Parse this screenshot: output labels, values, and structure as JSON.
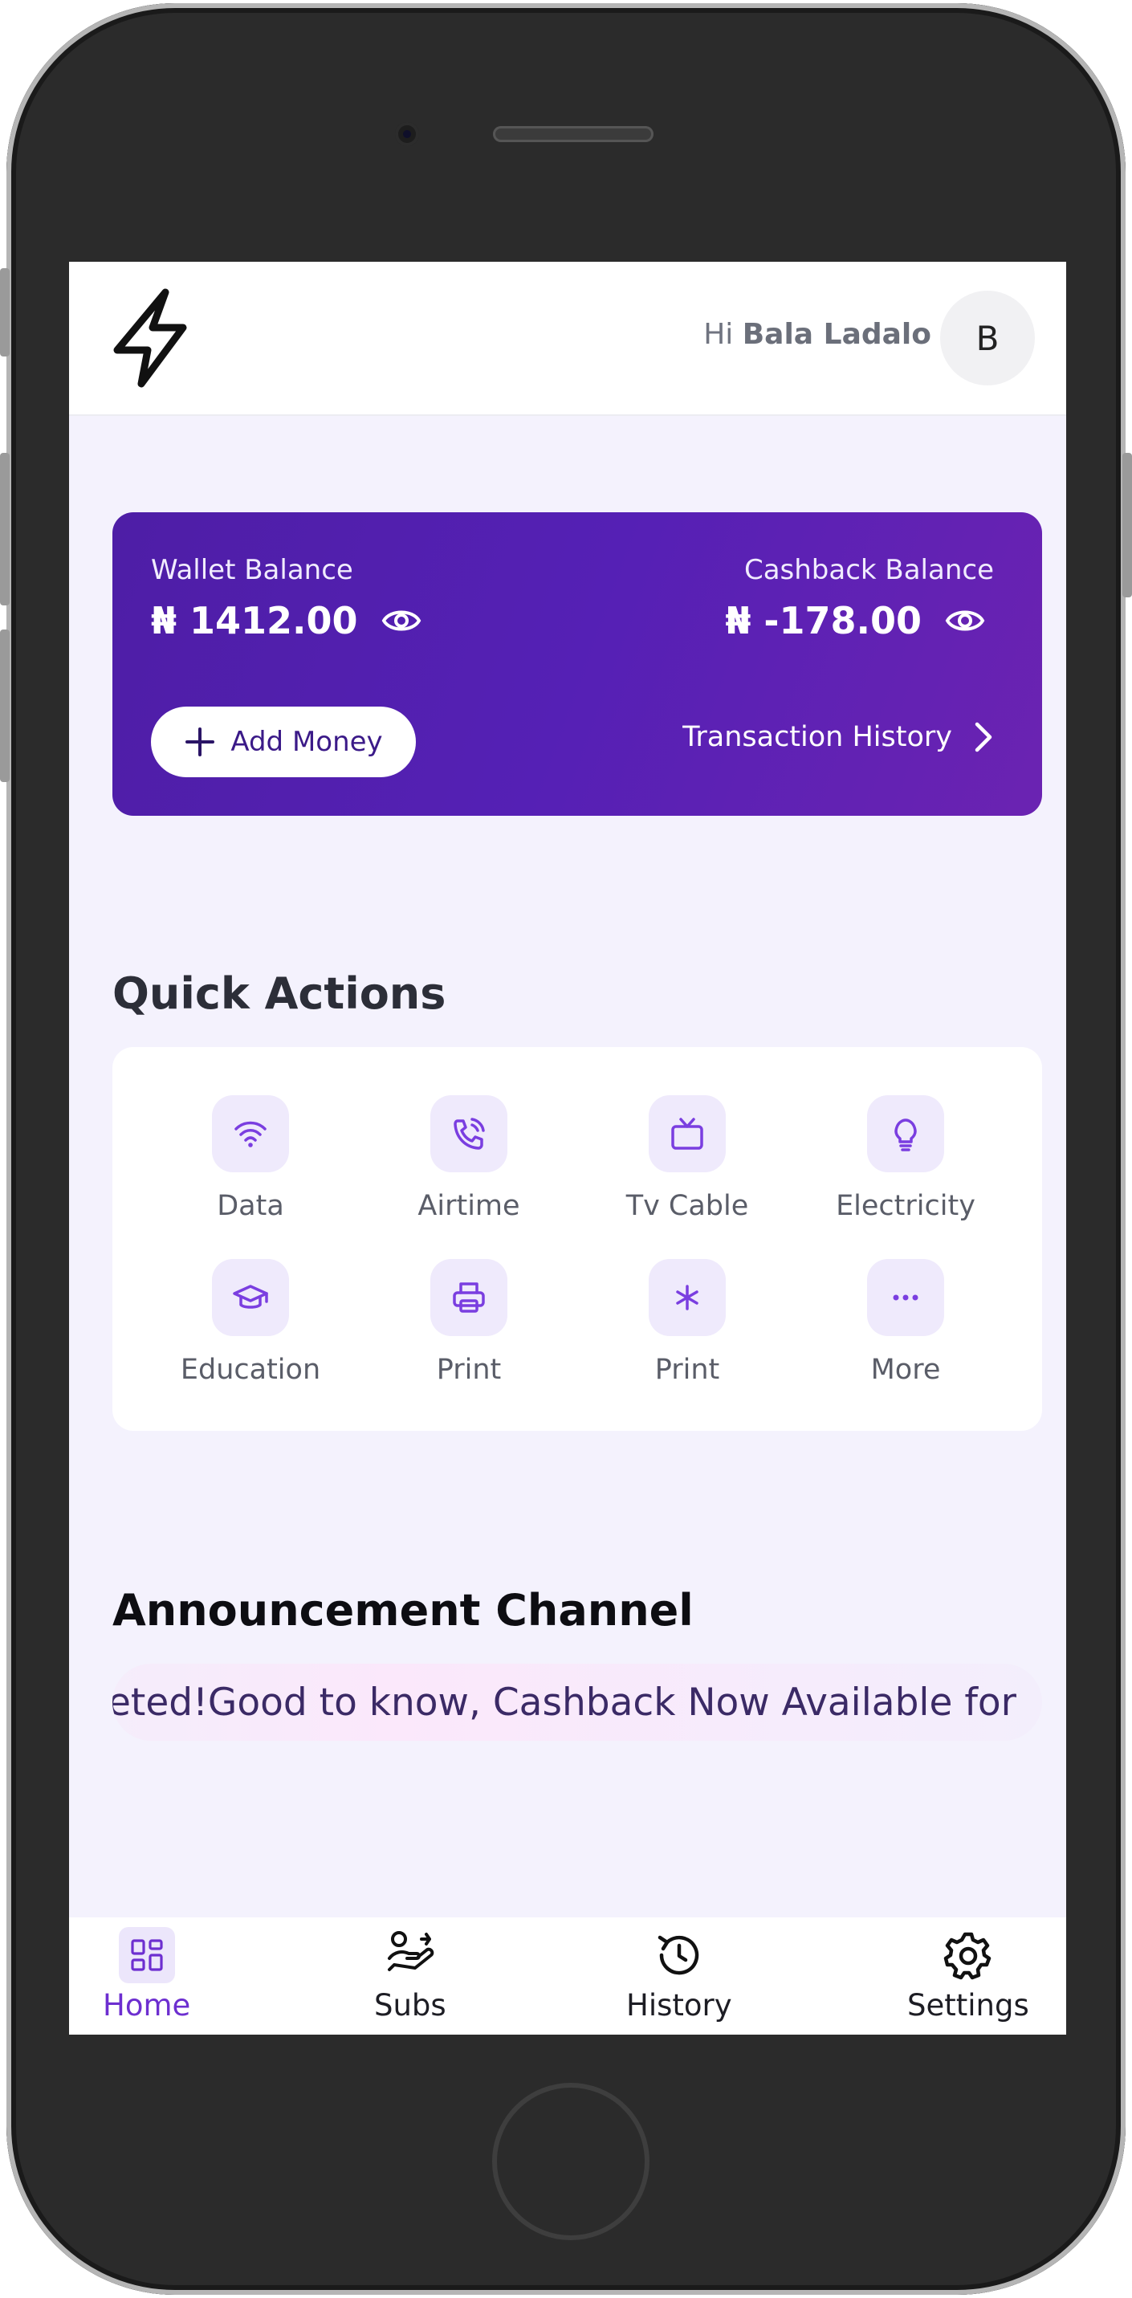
{
  "header": {
    "greeting_prefix": "Hi",
    "user_name": "Bala Ladalo",
    "avatar_initial": "B"
  },
  "wallet": {
    "wallet_label": "Wallet Balance",
    "wallet_amount": "₦ 1412.00",
    "cashback_label": "Cashback Balance",
    "cashback_amount": "₦ -178.00",
    "add_money_label": "Add Money",
    "transaction_history_label": "Transaction History",
    "card_color": "#5520b5"
  },
  "quick_actions": {
    "title": "Quick Actions",
    "items": [
      {
        "label": "Data",
        "icon": "wifi-icon"
      },
      {
        "label": "Airtime",
        "icon": "phone-call-icon"
      },
      {
        "label": "Tv Cable",
        "icon": "tv-icon"
      },
      {
        "label": "Electricity",
        "icon": "lightbulb-icon"
      },
      {
        "label": "Education",
        "icon": "graduation-cap-icon"
      },
      {
        "label": "Print",
        "icon": "printer-icon"
      },
      {
        "label": "Print",
        "icon": "asterisk-icon"
      },
      {
        "label": "More",
        "icon": "more-dots-icon"
      }
    ]
  },
  "announcement": {
    "title": "Announcement Channel",
    "ticker_text": "eted!Good to know, Cashback Now Available for"
  },
  "bottom_nav": {
    "items": [
      {
        "label": "Home",
        "icon": "dashboard-icon",
        "active": true
      },
      {
        "label": "Subs",
        "icon": "hand-coins-icon",
        "active": false
      },
      {
        "label": "History",
        "icon": "history-icon",
        "active": false
      },
      {
        "label": "Settings",
        "icon": "gear-icon",
        "active": false
      }
    ]
  },
  "colors": {
    "accent": "#6d2fd0",
    "screen_background": "#f4f2fd",
    "icon_tile": "#efeafc"
  }
}
